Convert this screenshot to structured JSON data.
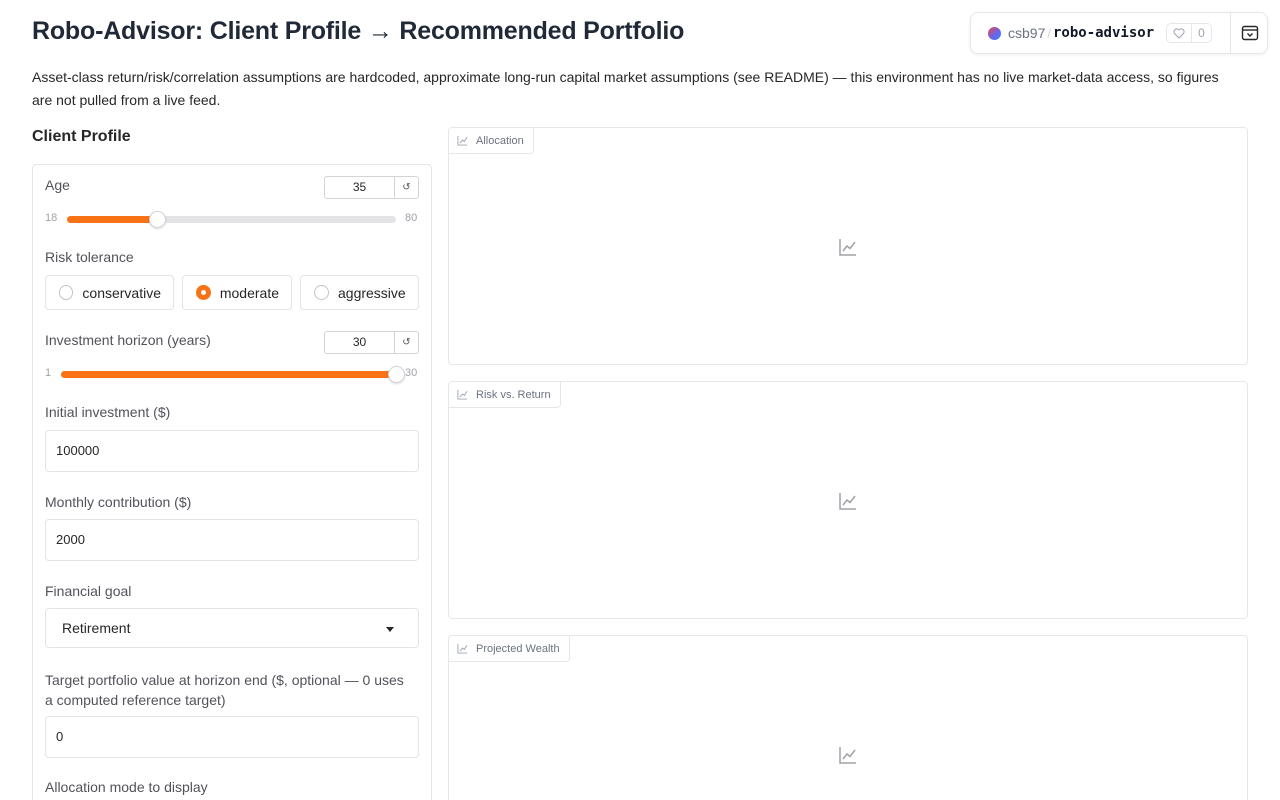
{
  "header": {
    "title": "Robo-Advisor: Client Profile → Recommended Portfolio",
    "description": "Asset-class return/risk/correlation assumptions are hardcoded, approximate long-run capital market assumptions (see README) — this environment has no live market-data access, so figures are not pulled from a live feed."
  },
  "space_badge": {
    "owner": "csb97",
    "separator": "/",
    "name": "robo-advisor",
    "likes": "0"
  },
  "client_profile": {
    "section_title": "Client Profile",
    "age": {
      "label": "Age",
      "value": "35",
      "min": "18",
      "max": "80",
      "fraction": 0.2742
    },
    "risk_tolerance": {
      "label": "Risk tolerance",
      "options": [
        "conservative",
        "moderate",
        "aggressive"
      ],
      "selected": "moderate"
    },
    "horizon": {
      "label": "Investment horizon (years)",
      "value": "30",
      "min": "1",
      "max": "30",
      "fraction": 1.0
    },
    "initial_investment": {
      "label": "Initial investment ($)",
      "value": "100000"
    },
    "monthly_contribution": {
      "label": "Monthly contribution ($)",
      "value": "2000"
    },
    "financial_goal": {
      "label": "Financial goal",
      "value": "Retirement"
    },
    "target_value": {
      "label": "Target portfolio value at horizon end ($, optional — 0 uses a computed reference target)",
      "value": "0"
    },
    "allocation_mode": {
      "label": "Allocation mode to display"
    }
  },
  "plots": [
    {
      "label": "Allocation"
    },
    {
      "label": "Risk vs. Return"
    },
    {
      "label": "Projected Wealth"
    }
  ],
  "icons": {
    "reset": "↺",
    "chart": "chart-icon",
    "heart": "heart-icon"
  },
  "colors": {
    "accent": "#f97316",
    "border": "#e5e7eb"
  }
}
